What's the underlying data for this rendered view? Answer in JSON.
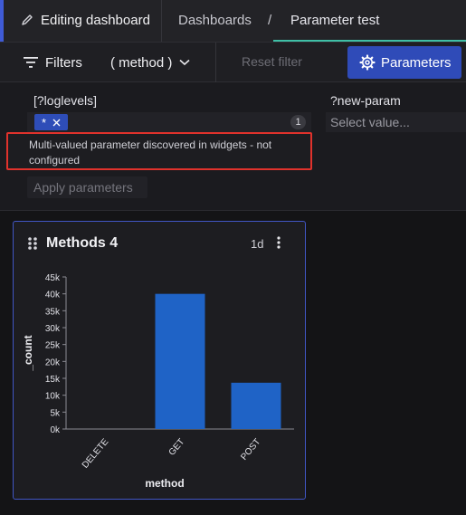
{
  "header": {
    "editing_label": "Editing dashboard",
    "breadcrumb_root": "Dashboards",
    "breadcrumb_sep": "/",
    "breadcrumb_current": "Parameter test"
  },
  "filterbar": {
    "filters_label": "Filters",
    "method_label": "( method )",
    "reset_label": "Reset filter",
    "parameters_label": "Parameters"
  },
  "params": {
    "p1_label": "[?loglevels]",
    "p1_chip": "*",
    "p1_count": "1",
    "p2_label": "?new-param",
    "p2_placeholder": "Select value...",
    "warning": "Multi-valued parameter discovered in widgets - not configured",
    "apply_label": "Apply parameters"
  },
  "widget": {
    "title": "Methods 4",
    "time_range": "1d"
  },
  "colors": {
    "bar": "#1f63c6",
    "accent": "#2f4bb8",
    "warning_border": "#e0322c"
  },
  "chart_data": {
    "type": "bar",
    "categories": [
      "DELETE",
      "GET",
      "POST"
    ],
    "values": [
      0,
      40000,
      13700
    ],
    "xlabel": "method",
    "ylabel": "_count",
    "ylim": [
      0,
      45000
    ],
    "yticks": [
      "0k",
      "5k",
      "10k",
      "15k",
      "20k",
      "25k",
      "30k",
      "35k",
      "40k",
      "45k"
    ],
    "grid": false
  }
}
